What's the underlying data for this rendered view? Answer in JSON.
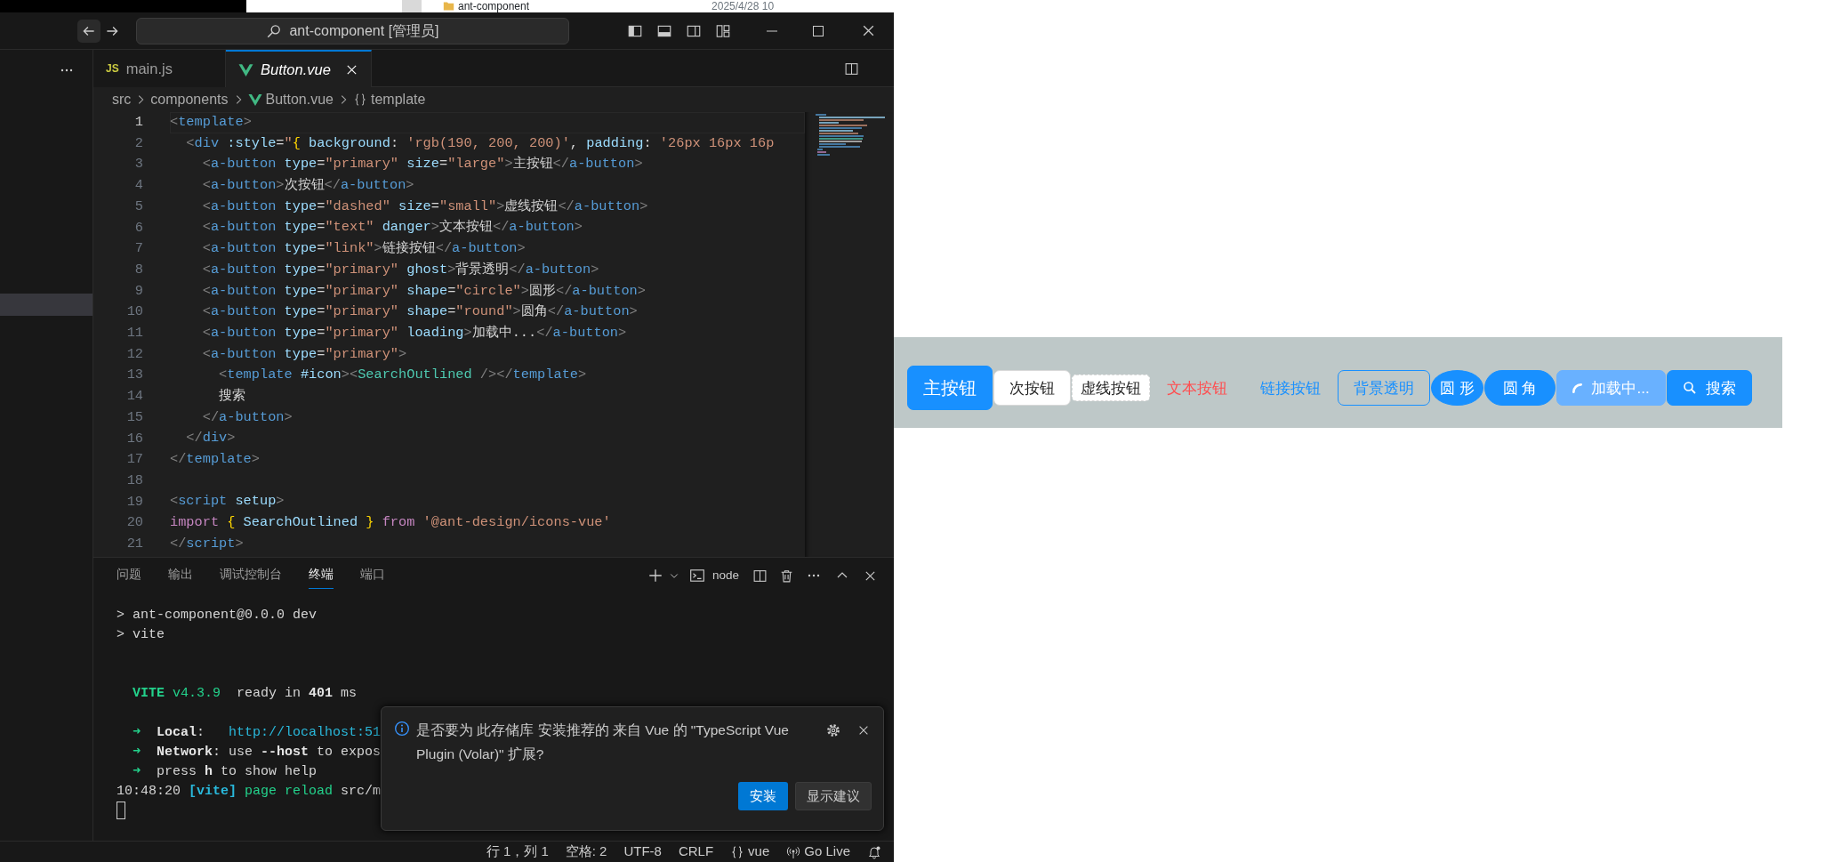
{
  "desktop_strip": {
    "folder_name": "ant-component",
    "date": "2025/4/28 10"
  },
  "title_bar": {
    "search_text": "ant-component [管理员]"
  },
  "tabs": [
    {
      "label": "main.js",
      "badge": "JS",
      "kind": "js",
      "selected": false,
      "preview": false
    },
    {
      "label": "Button.vue",
      "kind": "vue",
      "selected": true,
      "preview": true
    }
  ],
  "breadcrumb": [
    {
      "label": "src",
      "kind": "folder"
    },
    {
      "label": "components",
      "kind": "folder"
    },
    {
      "label": "Button.vue",
      "kind": "vue"
    },
    {
      "label": "template",
      "kind": "symbol"
    }
  ],
  "editor": {
    "lines": [
      {
        "number": "1",
        "current": true,
        "tokens": [
          {
            "kind": "punct",
            "text": "<"
          },
          {
            "kind": "tag",
            "text": "template"
          },
          {
            "kind": "punct",
            "text": ">"
          }
        ]
      },
      {
        "number": "2",
        "current": false,
        "tokens": [
          {
            "kind": "punct",
            "text": "  <"
          },
          {
            "kind": "tag",
            "text": "div"
          },
          {
            "kind": "attr",
            "text": " :style"
          },
          {
            "kind": "plain",
            "text": "="
          },
          {
            "kind": "str",
            "text": "\""
          },
          {
            "kind": "brace",
            "text": "{"
          },
          {
            "kind": "attr",
            "text": " background"
          },
          {
            "kind": "plain",
            "text": ": "
          },
          {
            "kind": "str",
            "text": "'rgb(190, 200, 200)'"
          },
          {
            "kind": "plain",
            "text": ", "
          },
          {
            "kind": "attr",
            "text": "padding"
          },
          {
            "kind": "plain",
            "text": ": "
          },
          {
            "kind": "str",
            "text": "'26px 16px 16p"
          }
        ]
      },
      {
        "number": "3",
        "current": false,
        "tokens": [
          {
            "kind": "punct",
            "text": "    <"
          },
          {
            "kind": "tag",
            "text": "a-button"
          },
          {
            "kind": "attr",
            "text": " type"
          },
          {
            "kind": "plain",
            "text": "="
          },
          {
            "kind": "str",
            "text": "\"primary\""
          },
          {
            "kind": "attr",
            "text": " size"
          },
          {
            "kind": "plain",
            "text": "="
          },
          {
            "kind": "str",
            "text": "\"large\""
          },
          {
            "kind": "punct",
            "text": ">"
          },
          {
            "kind": "plain",
            "text": "主按钮"
          },
          {
            "kind": "punct",
            "text": "</"
          },
          {
            "kind": "tag",
            "text": "a-button"
          },
          {
            "kind": "punct",
            "text": ">"
          }
        ]
      },
      {
        "number": "4",
        "current": false,
        "tokens": [
          {
            "kind": "punct",
            "text": "    <"
          },
          {
            "kind": "tag",
            "text": "a-button"
          },
          {
            "kind": "punct",
            "text": ">"
          },
          {
            "kind": "plain",
            "text": "次按钮"
          },
          {
            "kind": "punct",
            "text": "</"
          },
          {
            "kind": "tag",
            "text": "a-button"
          },
          {
            "kind": "punct",
            "text": ">"
          }
        ]
      },
      {
        "number": "5",
        "current": false,
        "tokens": [
          {
            "kind": "punct",
            "text": "    <"
          },
          {
            "kind": "tag",
            "text": "a-button"
          },
          {
            "kind": "attr",
            "text": " type"
          },
          {
            "kind": "plain",
            "text": "="
          },
          {
            "kind": "str",
            "text": "\"dashed\""
          },
          {
            "kind": "attr",
            "text": " size"
          },
          {
            "kind": "plain",
            "text": "="
          },
          {
            "kind": "str",
            "text": "\"small\""
          },
          {
            "kind": "punct",
            "text": ">"
          },
          {
            "kind": "plain",
            "text": "虚线按钮"
          },
          {
            "kind": "punct",
            "text": "</"
          },
          {
            "kind": "tag",
            "text": "a-button"
          },
          {
            "kind": "punct",
            "text": ">"
          }
        ]
      },
      {
        "number": "6",
        "current": false,
        "tokens": [
          {
            "kind": "punct",
            "text": "    <"
          },
          {
            "kind": "tag",
            "text": "a-button"
          },
          {
            "kind": "attr",
            "text": " type"
          },
          {
            "kind": "plain",
            "text": "="
          },
          {
            "kind": "str",
            "text": "\"text\""
          },
          {
            "kind": "attr",
            "text": " danger"
          },
          {
            "kind": "punct",
            "text": ">"
          },
          {
            "kind": "plain",
            "text": "文本按钮"
          },
          {
            "kind": "punct",
            "text": "</"
          },
          {
            "kind": "tag",
            "text": "a-button"
          },
          {
            "kind": "punct",
            "text": ">"
          }
        ]
      },
      {
        "number": "7",
        "current": false,
        "tokens": [
          {
            "kind": "punct",
            "text": "    <"
          },
          {
            "kind": "tag",
            "text": "a-button"
          },
          {
            "kind": "attr",
            "text": " type"
          },
          {
            "kind": "plain",
            "text": "="
          },
          {
            "kind": "str",
            "text": "\"link\""
          },
          {
            "kind": "punct",
            "text": ">"
          },
          {
            "kind": "plain",
            "text": "链接按钮"
          },
          {
            "kind": "punct",
            "text": "</"
          },
          {
            "kind": "tag",
            "text": "a-button"
          },
          {
            "kind": "punct",
            "text": ">"
          }
        ]
      },
      {
        "number": "8",
        "current": false,
        "tokens": [
          {
            "kind": "punct",
            "text": "    <"
          },
          {
            "kind": "tag",
            "text": "a-button"
          },
          {
            "kind": "attr",
            "text": " type"
          },
          {
            "kind": "plain",
            "text": "="
          },
          {
            "kind": "str",
            "text": "\"primary\""
          },
          {
            "kind": "attr",
            "text": " ghost"
          },
          {
            "kind": "punct",
            "text": ">"
          },
          {
            "kind": "plain",
            "text": "背景透明"
          },
          {
            "kind": "punct",
            "text": "</"
          },
          {
            "kind": "tag",
            "text": "a-button"
          },
          {
            "kind": "punct",
            "text": ">"
          }
        ]
      },
      {
        "number": "9",
        "current": false,
        "tokens": [
          {
            "kind": "punct",
            "text": "    <"
          },
          {
            "kind": "tag",
            "text": "a-button"
          },
          {
            "kind": "attr",
            "text": " type"
          },
          {
            "kind": "plain",
            "text": "="
          },
          {
            "kind": "str",
            "text": "\"primary\""
          },
          {
            "kind": "attr",
            "text": " shape"
          },
          {
            "kind": "plain",
            "text": "="
          },
          {
            "kind": "str",
            "text": "\"circle\""
          },
          {
            "kind": "punct",
            "text": ">"
          },
          {
            "kind": "plain",
            "text": "圆形"
          },
          {
            "kind": "punct",
            "text": "</"
          },
          {
            "kind": "tag",
            "text": "a-button"
          },
          {
            "kind": "punct",
            "text": ">"
          }
        ]
      },
      {
        "number": "10",
        "current": false,
        "tokens": [
          {
            "kind": "punct",
            "text": "    <"
          },
          {
            "kind": "tag",
            "text": "a-button"
          },
          {
            "kind": "attr",
            "text": " type"
          },
          {
            "kind": "plain",
            "text": "="
          },
          {
            "kind": "str",
            "text": "\"primary\""
          },
          {
            "kind": "attr",
            "text": " shape"
          },
          {
            "kind": "plain",
            "text": "="
          },
          {
            "kind": "str",
            "text": "\"round\""
          },
          {
            "kind": "punct",
            "text": ">"
          },
          {
            "kind": "plain",
            "text": "圆角"
          },
          {
            "kind": "punct",
            "text": "</"
          },
          {
            "kind": "tag",
            "text": "a-button"
          },
          {
            "kind": "punct",
            "text": ">"
          }
        ]
      },
      {
        "number": "11",
        "current": false,
        "tokens": [
          {
            "kind": "punct",
            "text": "    <"
          },
          {
            "kind": "tag",
            "text": "a-button"
          },
          {
            "kind": "attr",
            "text": " type"
          },
          {
            "kind": "plain",
            "text": "="
          },
          {
            "kind": "str",
            "text": "\"primary\""
          },
          {
            "kind": "attr",
            "text": " loading"
          },
          {
            "kind": "punct",
            "text": ">"
          },
          {
            "kind": "plain",
            "text": "加载中..."
          },
          {
            "kind": "punct",
            "text": "</"
          },
          {
            "kind": "tag",
            "text": "a-button"
          },
          {
            "kind": "punct",
            "text": ">"
          }
        ]
      },
      {
        "number": "12",
        "current": false,
        "tokens": [
          {
            "kind": "punct",
            "text": "    <"
          },
          {
            "kind": "tag",
            "text": "a-button"
          },
          {
            "kind": "attr",
            "text": " type"
          },
          {
            "kind": "plain",
            "text": "="
          },
          {
            "kind": "str",
            "text": "\"primary\""
          },
          {
            "kind": "punct",
            "text": ">"
          }
        ]
      },
      {
        "number": "13",
        "current": false,
        "tokens": [
          {
            "kind": "punct",
            "text": "      <"
          },
          {
            "kind": "tag",
            "text": "template"
          },
          {
            "kind": "attr",
            "text": " #icon"
          },
          {
            "kind": "punct",
            "text": ">"
          },
          {
            "kind": "punct",
            "text": "<"
          },
          {
            "kind": "comp",
            "text": "SearchOutlined"
          },
          {
            "kind": "punct",
            "text": " />"
          },
          {
            "kind": "punct",
            "text": "</"
          },
          {
            "kind": "tag",
            "text": "template"
          },
          {
            "kind": "punct",
            "text": ">"
          }
        ]
      },
      {
        "number": "14",
        "current": false,
        "tokens": [
          {
            "kind": "plain",
            "text": "      搜索"
          }
        ]
      },
      {
        "number": "15",
        "current": false,
        "tokens": [
          {
            "kind": "punct",
            "text": "    </"
          },
          {
            "kind": "tag",
            "text": "a-button"
          },
          {
            "kind": "punct",
            "text": ">"
          }
        ]
      },
      {
        "number": "16",
        "current": false,
        "tokens": [
          {
            "kind": "punct",
            "text": "  </"
          },
          {
            "kind": "tag",
            "text": "div"
          },
          {
            "kind": "punct",
            "text": ">"
          }
        ]
      },
      {
        "number": "17",
        "current": false,
        "tokens": [
          {
            "kind": "punct",
            "text": "</"
          },
          {
            "kind": "tag",
            "text": "template"
          },
          {
            "kind": "punct",
            "text": ">"
          }
        ]
      },
      {
        "number": "18",
        "current": false
      },
      {
        "number": "19",
        "current": false,
        "tokens": [
          {
            "kind": "punct",
            "text": "<"
          },
          {
            "kind": "tag",
            "text": "script"
          },
          {
            "kind": "attr",
            "text": " setup"
          },
          {
            "kind": "punct",
            "text": ">"
          }
        ]
      },
      {
        "number": "20",
        "current": false,
        "tokens": [
          {
            "kind": "kw",
            "text": "import"
          },
          {
            "kind": "brace",
            "text": " {"
          },
          {
            "kind": "attr",
            "text": " SearchOutlined"
          },
          {
            "kind": "brace",
            "text": " }"
          },
          {
            "kind": "kw",
            "text": " from"
          },
          {
            "kind": "str",
            "text": " '@ant-design/icons-vue'"
          }
        ]
      },
      {
        "number": "21",
        "current": false,
        "tokens": [
          {
            "kind": "punct",
            "text": "</"
          },
          {
            "kind": "tag",
            "text": "script"
          },
          {
            "kind": "punct",
            "text": ">"
          }
        ]
      }
    ]
  },
  "panel": {
    "tabs": [
      {
        "label": "问题",
        "selected": false
      },
      {
        "label": "输出",
        "selected": false
      },
      {
        "label": "调试控制台",
        "selected": false
      },
      {
        "label": "终端",
        "selected": true
      },
      {
        "label": "端口",
        "selected": false
      }
    ],
    "terminal_profile": "node",
    "terminal_lines": [
      {
        "kind": "line",
        "tokens": [
          {
            "kind": "plain",
            "text": "> ant-component@0.0.0 dev"
          }
        ]
      },
      {
        "kind": "line",
        "tokens": [
          {
            "kind": "plain",
            "text": "> vite"
          }
        ]
      },
      {
        "kind": "after-two-blanks",
        "tokens": [
          {
            "kind": "greenbold",
            "text": "  VITE"
          },
          {
            "kind": "green",
            "text": " v4.3.9"
          },
          {
            "kind": "plain",
            "text": "  ready in "
          },
          {
            "kind": "bold",
            "text": "401"
          },
          {
            "kind": "plain",
            "text": " ms"
          }
        ]
      },
      {
        "kind": "after-blank",
        "tokens": [
          {
            "kind": "green",
            "text": "  ➜  "
          },
          {
            "kind": "bold",
            "text": "Local"
          },
          {
            "kind": "plain",
            "text": ":   "
          },
          {
            "kind": "cyan",
            "text": "http://localhost:51"
          }
        ]
      },
      {
        "kind": "line",
        "tokens": [
          {
            "kind": "green",
            "text": "  ➜  "
          },
          {
            "kind": "bold",
            "text": "Network"
          },
          {
            "kind": "plain",
            "text": ": use "
          },
          {
            "kind": "bold",
            "text": "--host"
          },
          {
            "kind": "plain",
            "text": " to expos"
          }
        ]
      },
      {
        "kind": "line",
        "tokens": [
          {
            "kind": "green",
            "text": "  ➜  "
          },
          {
            "kind": "plain",
            "text": "press "
          },
          {
            "kind": "bold",
            "text": "h"
          },
          {
            "kind": "plain",
            "text": " to show help"
          }
        ]
      },
      {
        "kind": "line",
        "tokens": [
          {
            "kind": "plain",
            "text": "10:48:20"
          },
          {
            "kind": "cyanbold",
            "text": " [vite]"
          },
          {
            "kind": "green",
            "text": " page reload"
          },
          {
            "kind": "plain",
            "text": " src/m"
          }
        ]
      }
    ]
  },
  "notification": {
    "message": "是否要为 此存储库 安装推荐的 来自 Vue 的 \"TypeScript Vue Plugin (Volar)\" 扩展?",
    "buttons": [
      {
        "label": "安装",
        "kind": "primary"
      },
      {
        "label": "显示建议",
        "kind": "secondary"
      }
    ]
  },
  "status_bar": [
    {
      "label": "行 1，列 1",
      "kind": "text"
    },
    {
      "label": "空格: 2",
      "kind": "text"
    },
    {
      "label": "UTF-8",
      "kind": "text"
    },
    {
      "label": "CRLF",
      "kind": "text"
    },
    {
      "label": "vue",
      "kind": "language"
    },
    {
      "label": "Go Live",
      "kind": "live"
    },
    {
      "kind": "notifications"
    }
  ],
  "preview": {
    "buttons": [
      {
        "label": "主按钮",
        "kind": "primary-large"
      },
      {
        "label": "次按钮",
        "kind": "default"
      },
      {
        "label": "虚线按钮",
        "kind": "dashed-small"
      },
      {
        "label": "文本按钮",
        "kind": "text-danger"
      },
      {
        "label": "链接按钮",
        "kind": "link"
      },
      {
        "label": "背景透明",
        "kind": "ghost"
      },
      {
        "label": "圆 形",
        "kind": "circle"
      },
      {
        "label": "圆 角",
        "kind": "round"
      },
      {
        "label": "加载中...",
        "kind": "loading"
      },
      {
        "label": "搜索",
        "kind": "with-icon"
      }
    ]
  }
}
